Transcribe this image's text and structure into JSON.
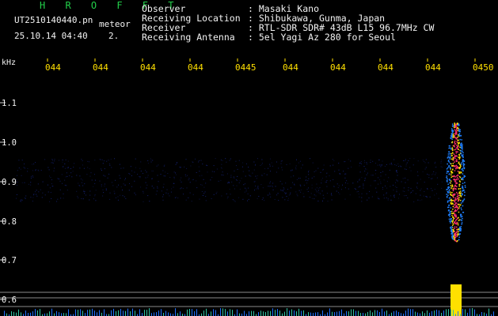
{
  "header": {
    "title": "H R O F F T",
    "filename": "UT2510140440.pn",
    "detection_label": "meteor",
    "date_time": "25.10.14 04:40",
    "detection_count": "2."
  },
  "info": [
    {
      "label": "Observer",
      "value": ": Masaki Kano"
    },
    {
      "label": "Receiving Location",
      "value": ": Shibukawa, Gunma, Japan"
    },
    {
      "label": "Receiver",
      "value": ": RTL-SDR SDR# 43dB L15 96.7MHz CW"
    },
    {
      "label": "Receiving Antenna",
      "value": ": 5el Yagi Az 280 for Seoul"
    }
  ],
  "axis": {
    "y_unit": "kHz",
    "time_ticks": [
      "044",
      "044",
      "044",
      "044",
      "0445",
      "044",
      "044",
      "044",
      "044",
      "0450"
    ],
    "freq_ticks": [
      "1.1",
      "1.0",
      "0.9",
      "0.8",
      "0.7",
      "0.6"
    ]
  },
  "colors": {
    "labels": "#22d04a",
    "text": "#f2f2f2",
    "ticks": "#ffe000",
    "echo_core": "#ff3070",
    "echo_mid": "#ffe000",
    "echo_edge": "#2080ff"
  }
}
